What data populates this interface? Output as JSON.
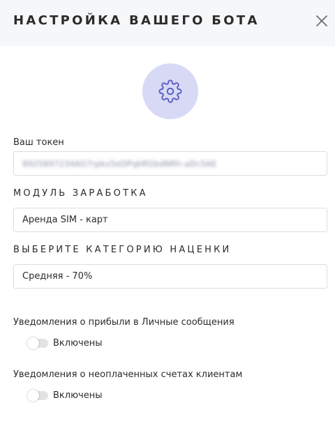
{
  "header": {
    "title": "НАСТРОЙКА ВАШЕГО БОТА",
    "close_icon": "close-icon"
  },
  "avatar": {
    "icon": "gear-icon",
    "background": "#d8d9f5",
    "icon_color": "#5a5fc4"
  },
  "token": {
    "label": "Ваш токен",
    "value": "8925897234AG7rpkx5eDPqkRGbdNRh-aDc5AE"
  },
  "earning_module": {
    "label": "МОДУЛЬ ЗАРАБОТКА",
    "value": "Аренда SIM - карт"
  },
  "markup_category": {
    "label": "ВЫБЕРИТЕ КАТЕГОРИЮ НАЦЕНКИ",
    "value": "Средняя - 70%"
  },
  "notifications": [
    {
      "label": "Уведомления о прибыли в Личные сообщения",
      "toggle_label": "Включены",
      "enabled": false
    },
    {
      "label": "Уведомления о неоплаченных счетах клиентам",
      "toggle_label": "Включены",
      "enabled": false
    }
  ]
}
